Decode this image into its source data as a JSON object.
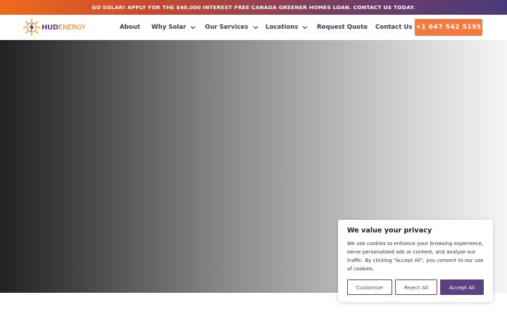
{
  "promo_bar": {
    "text": "GO SOLAR! APPLY FOR THE $40,000 INTEREST FREE CANADA GREENER HOMES LOAN. CONTACT US TODAY."
  },
  "logo": {
    "part1": "HUD",
    "part2": "ENERGY",
    "icon": "sun-bolt-icon"
  },
  "nav": {
    "about": "About",
    "why_solar": "Why Solar",
    "our_services": "Our Services",
    "locations": "Locations",
    "request_quote": "Request Quote",
    "contact_us": "Contact Us"
  },
  "call_button": {
    "label": "+1 647 542 5195"
  },
  "cookie_banner": {
    "title": "We value your privacy",
    "text": "We use cookies to enhance your browsing experience, serve personalized ads or content, and analyze our traffic. By clicking \"Accept All\", you consent to our use of cookies.",
    "customize": "Customize",
    "reject": "Reject All",
    "accept": "Accept All"
  },
  "colors": {
    "accent_orange": "#f47a3d",
    "brand_purple": "#5b4180",
    "nav_text": "#3a3a55"
  }
}
